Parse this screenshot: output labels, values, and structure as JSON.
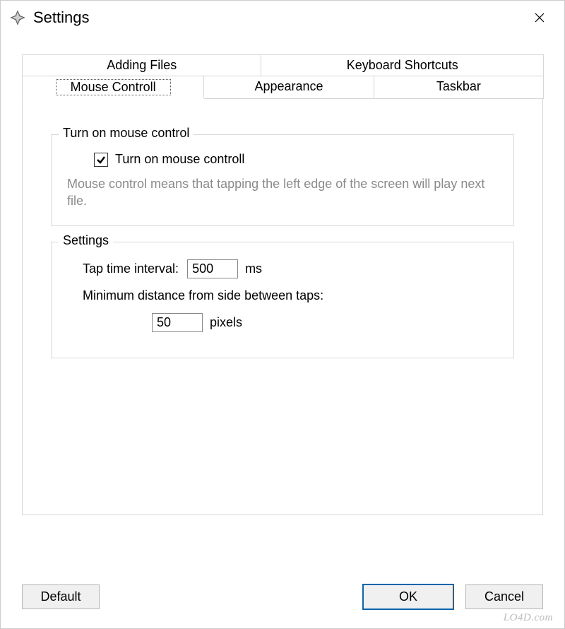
{
  "window": {
    "title": "Settings"
  },
  "tabs": {
    "top": [
      {
        "label": "Adding Files"
      },
      {
        "label": "Keyboard Shortcuts"
      }
    ],
    "bottom": [
      {
        "label": "Mouse Controll",
        "active": true
      },
      {
        "label": "Appearance"
      },
      {
        "label": "Taskbar"
      }
    ]
  },
  "group_mouse": {
    "legend": "Turn on mouse control",
    "checkbox_label": "Turn on mouse controll",
    "checkbox_checked": true,
    "help_text": "Mouse control means that tapping the left edge of the screen will play next file."
  },
  "group_settings": {
    "legend": "Settings",
    "tap_interval_label": "Tap time interval:",
    "tap_interval_value": "500",
    "tap_interval_unit": "ms",
    "min_distance_label": "Minimum distance from side between taps:",
    "min_distance_value": "50",
    "min_distance_unit": "pixels"
  },
  "buttons": {
    "default": "Default",
    "ok": "OK",
    "cancel": "Cancel"
  },
  "watermark": "LO4D.com"
}
